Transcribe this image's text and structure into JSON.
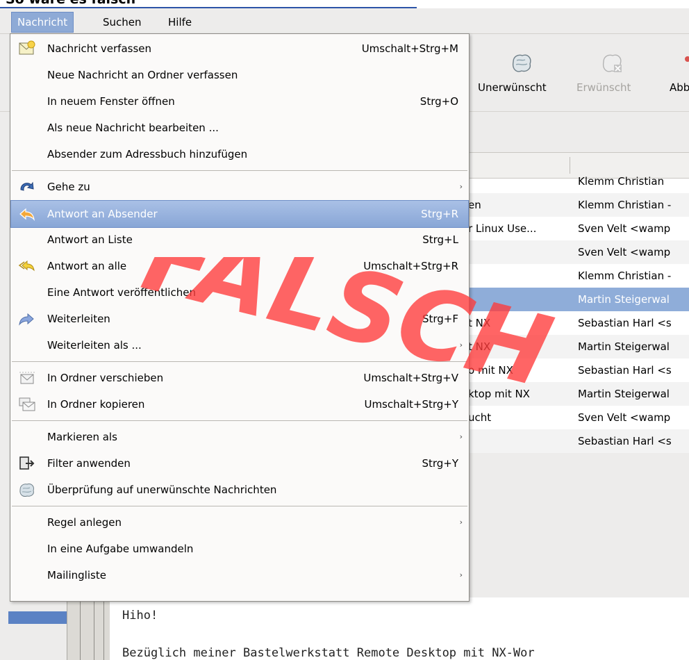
{
  "caption": {
    "text_prefix": "So wäre es ",
    "text_bold_tail": "falsch"
  },
  "menubar": {
    "items": [
      {
        "label": "Nachricht",
        "active": true
      },
      {
        "label": "Suchen",
        "active": false
      },
      {
        "label": "Hilfe",
        "active": false
      }
    ]
  },
  "toolbar": {
    "unwanted_label": "Unerwünscht",
    "wanted_label": "Erwünscht",
    "cut_label": "Abb"
  },
  "message_list": {
    "rows": [
      {
        "subject": "",
        "from": "Klemm Christian"
      },
      {
        "subject": "en",
        "from": "Klemm Christian -"
      },
      {
        "subject": "r Linux Use...",
        "from": "Sven Velt <wamp"
      },
      {
        "subject": "",
        "from": "Sven Velt <wamp"
      },
      {
        "subject": "",
        "from": "Klemm Christian -"
      },
      {
        "subject": "",
        "from": "Martin Steigerwal",
        "selected": true
      },
      {
        "subject": "t NX",
        "from": "Sebastian Harl <s"
      },
      {
        "subject": "t NX",
        "from": "Martin Steigerwal"
      },
      {
        "subject": "o mit NX",
        "from": "Sebastian Harl <s"
      },
      {
        "subject": "ktop mit NX",
        "from": "Martin Steigerwal"
      },
      {
        "subject": "ucht",
        "from": "Sven Velt <wamp"
      },
      {
        "subject": "",
        "from": "Sebastian Harl <s"
      }
    ]
  },
  "preview": {
    "line1": "Hiho!",
    "line2": "Bezüglich meiner Bastelwerkstatt Remote Desktop mit NX-Wor"
  },
  "menu": {
    "items": [
      {
        "label": "Nachricht verfassen",
        "accel": "Umschalt+Strg+M",
        "icon": "compose-icon"
      },
      {
        "label": "Neue Nachricht an Ordner verfassen",
        "accel": ""
      },
      {
        "label": "In neuem Fenster öffnen",
        "accel": "Strg+O"
      },
      {
        "label": "Als neue Nachricht bearbeiten ...",
        "accel": ""
      },
      {
        "label": "Absender zum Adressbuch hinzufügen",
        "accel": ""
      },
      {
        "label": "Gehe zu",
        "accel": "",
        "submenu": true,
        "icon": "goto-arrow-icon"
      },
      {
        "label": "Antwort an Absender",
        "accel": "Strg+R",
        "highlighted": true,
        "icon": "reply-icon"
      },
      {
        "label": "Antwort an Liste",
        "accel": "Strg+L"
      },
      {
        "label": "Antwort an alle",
        "accel": "Umschalt+Strg+R",
        "icon": "reply-all-icon"
      },
      {
        "label": "Eine Antwort veröffentlichen",
        "accel": ""
      },
      {
        "label": "Weiterleiten",
        "accel": "Strg+F",
        "icon": "forward-icon"
      },
      {
        "label": "Weiterleiten als ...",
        "accel": "",
        "submenu": true
      },
      {
        "label": "In Ordner verschieben",
        "accel": "Umschalt+Strg+V",
        "icon": "move-to-folder-icon"
      },
      {
        "label": "In Ordner kopieren",
        "accel": "Umschalt+Strg+Y",
        "icon": "copy-to-folder-icon"
      },
      {
        "label": "Markieren als",
        "accel": "",
        "submenu": true
      },
      {
        "label": "Filter anwenden",
        "accel": "Strg+Y",
        "icon": "filter-icon"
      },
      {
        "label": "Überprüfung auf unerwünschte Nachrichten",
        "accel": "",
        "icon": "junk-check-icon"
      },
      {
        "label": "Regel anlegen",
        "accel": "",
        "submenu": true
      },
      {
        "label": "In eine Aufgabe umwandeln",
        "accel": ""
      },
      {
        "label": "Mailingliste",
        "accel": "",
        "submenu": true
      }
    ]
  },
  "overlay": {
    "stamp_text": "FALSCH",
    "color": "#ff3b3b"
  },
  "colors": {
    "highlight": "#88a6d6",
    "selected_row": "#8fadd9"
  }
}
